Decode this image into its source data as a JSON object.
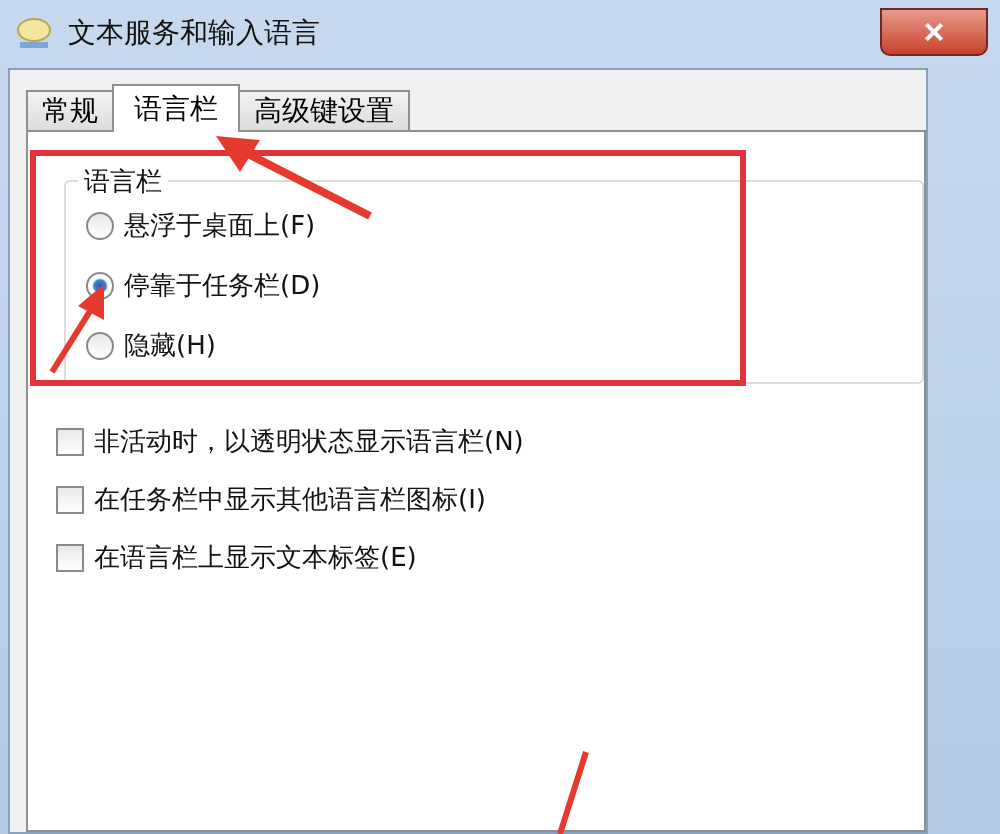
{
  "window": {
    "title": "文本服务和输入语言",
    "close": "×"
  },
  "tabs": [
    {
      "label": "常规",
      "selected": false
    },
    {
      "label": "语言栏",
      "selected": true
    },
    {
      "label": "高级键设置",
      "selected": false
    }
  ],
  "language_bar": {
    "title": "语言栏",
    "options": [
      {
        "label": "悬浮于桌面上(F)",
        "selected": false
      },
      {
        "label": "停靠于任务栏(D)",
        "selected": true
      },
      {
        "label": "隐藏(H)",
        "selected": false
      }
    ]
  },
  "checkboxes": [
    {
      "label": "非活动时，以透明状态显示语言栏(N)",
      "checked": false
    },
    {
      "label": "在任务栏中显示其他语言栏图标(I)",
      "checked": false
    },
    {
      "label": "在语言栏上显示文本标签(E)",
      "checked": false
    }
  ]
}
